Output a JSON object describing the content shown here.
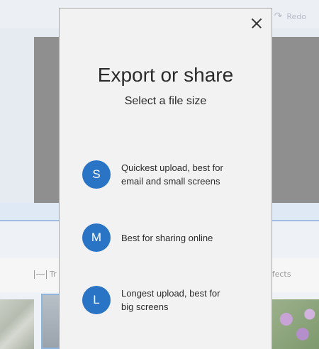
{
  "background": {
    "redo_label": "Redo",
    "toolbar": {
      "trim_label": "Tr",
      "effects_label": "ffects"
    }
  },
  "dialog": {
    "title": "Export or share",
    "subtitle": "Select a file size",
    "close_icon": "close-icon",
    "options": [
      {
        "badge": "S",
        "description": "Quickest upload, best for email and small screens"
      },
      {
        "badge": "M",
        "description": "Best for sharing online"
      },
      {
        "badge": "L",
        "description": "Longest upload, best for big screens"
      }
    ]
  },
  "colors": {
    "accent": "#2a74c6",
    "dialog_bg": "#f2f2f2"
  }
}
